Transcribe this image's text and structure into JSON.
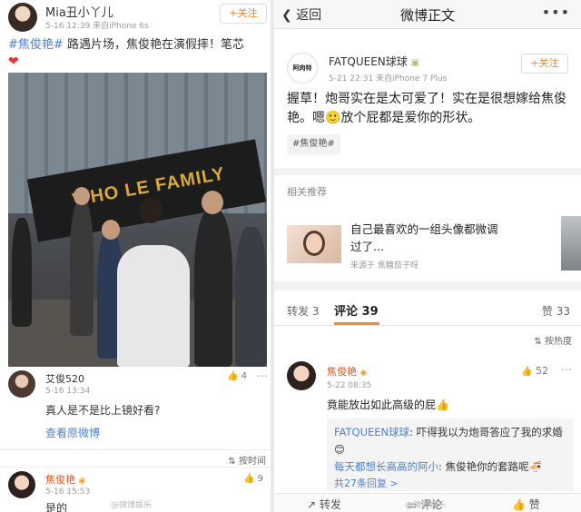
{
  "left_post": {
    "author": "Mia丑小丫儿",
    "meta": "5-16 12:39  来自iPhone 6s",
    "follow_label": "+关注",
    "topic": "#焦俊艳#",
    "text": "路遇片场，焦俊艳在演假摔！笔芯",
    "heart": "❤",
    "photo_sign": "WHO LE FAMILY",
    "comment1": {
      "name": "艾俊520",
      "time": "5-16 13:34",
      "text": "真人是不是比上镜好看?",
      "likes": "4",
      "view_original": "查看原微博"
    },
    "sort_label": "按时间",
    "comment2": {
      "name": "焦俊艳",
      "time": "5-16 15:53",
      "text": "是的",
      "likes": "9"
    }
  },
  "right_post": {
    "nav": {
      "back_label": "返回",
      "title": "微博正文",
      "more": "•••"
    },
    "author": "FATQUEEN球球",
    "avatar_text": "阿肉特",
    "meta": "5-21 22:31  来自iPhone 7 Plus",
    "follow_label": "+关注",
    "text": "握草！炮哥实在是太可爱了！实在是很想嫁给焦俊艳。嗯🙂放个屁都是爱你的形状。",
    "tag": "#焦俊艳#",
    "related_label": "相关推荐",
    "related": {
      "title": "自己最喜欢的一组头像都微调过了...",
      "source": "来源于 焦糖茄子呀"
    },
    "tabs": {
      "repost": "转发 3",
      "comments": "评论 39",
      "likes": "赞 33"
    },
    "sort_label": "按热度",
    "comment": {
      "name": "焦俊艳",
      "time": "5-22 08:35",
      "likes": "52",
      "text": "竟能放出如此高级的屁👍",
      "replies": [
        {
          "user": "FATQUEEN球球",
          "text": ": 吓得我以为炮哥答应了我的求婚😊"
        },
        {
          "user": "每天都想长高高的阿小",
          "text": ": 焦俊艳你的套路呢🍜"
        }
      ],
      "reply_count": "共27条回复 >"
    },
    "bottom_bar": {
      "repost": "转发",
      "comment": "评论",
      "like": "赞"
    }
  },
  "watermarks": [
    "@微博娱乐",
    "@微博娱乐"
  ],
  "colors": {
    "accent_orange": "#f18430",
    "link_blue": "#4f7fd1",
    "verified_name": "#e0561a"
  }
}
